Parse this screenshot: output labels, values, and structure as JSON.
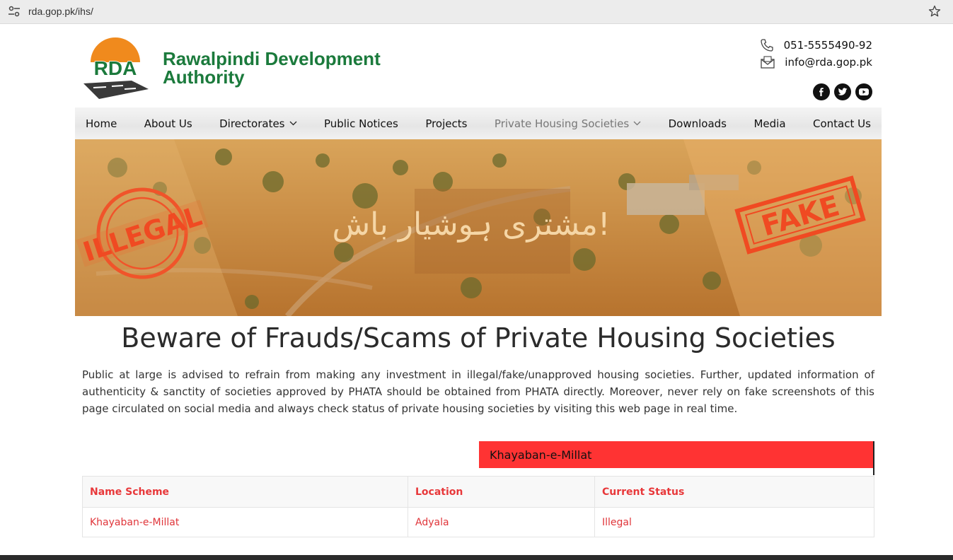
{
  "browser": {
    "url": "rda.gop.pk/ihs/",
    "site_info_icon": "tune-icon",
    "bookmark_icon": "star-icon"
  },
  "header": {
    "logo_text": "RDA",
    "org_name": "Rawalpindi Development Authority",
    "phone": "051-5555490-92",
    "email": "info@rda.gop.pk",
    "socials": [
      "facebook-icon",
      "twitter-icon",
      "youtube-icon"
    ]
  },
  "nav": {
    "items": [
      {
        "label": "Home"
      },
      {
        "label": "About Us"
      },
      {
        "label": "Directorates",
        "dropdown": true
      },
      {
        "label": "Public Notices"
      },
      {
        "label": "Projects"
      },
      {
        "label": "Private Housing Societies",
        "dropdown": true,
        "active": true
      },
      {
        "label": "Downloads"
      },
      {
        "label": "Media"
      },
      {
        "label": "Contact Us"
      }
    ]
  },
  "banner": {
    "stamp_left": "ILLEGAL",
    "stamp_right": "FAKE",
    "urdu_text": "مشتری ہوشیار باش!"
  },
  "main": {
    "title": "Beware of Frauds/Scams of Private Housing Societies",
    "advice": "Public at large is advised to refrain from making any investment in illegal/fake/unapproved housing societies. Further, updated information of authenticity & sanctity of societies approved by PHATA should be obtained from PHATA directly. Moreover, never rely on fake screenshots of this page circulated on social media and always check status of private housing societies by visiting this web page in real time.",
    "search_value": "Khayaban-e-Millat",
    "table": {
      "headers": [
        "Name Scheme",
        "Location",
        "Current Status"
      ],
      "rows": [
        [
          "Khayaban-e-Millat",
          "Adyala",
          "Illegal"
        ]
      ]
    }
  },
  "colors": {
    "brand_green": "#1b7a3c",
    "logo_orange": "#f08a1d",
    "alert_red": "#ff3333",
    "table_text": "#e0353a"
  }
}
